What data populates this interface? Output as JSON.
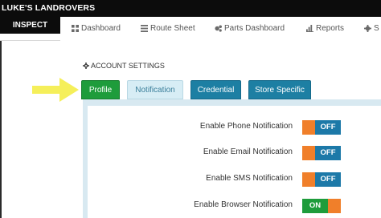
{
  "window": {
    "title": "LUKE'S LANDROVERS"
  },
  "nav": {
    "active_tab": "INSPECT",
    "items": [
      {
        "label": "Dashboard",
        "icon": "grid-icon"
      },
      {
        "label": "Route Sheet",
        "icon": "list-icon"
      },
      {
        "label": "Parts Dashboard",
        "icon": "gears-icon"
      },
      {
        "label": "Reports",
        "icon": "bar-chart-icon"
      },
      {
        "label": "S",
        "icon": "gear-icon"
      }
    ]
  },
  "settings": {
    "heading": "ACCOUNT SETTINGS",
    "tabs": [
      {
        "label": "Profile",
        "state": "active"
      },
      {
        "label": "Notification",
        "state": "highlighted"
      },
      {
        "label": "Credential",
        "state": "normal"
      },
      {
        "label": "Store Specific",
        "state": "normal"
      }
    ]
  },
  "notifications": [
    {
      "label": "Enable Phone Notification",
      "state": "OFF",
      "enabled": false
    },
    {
      "label": "Enable Email Notification",
      "state": "OFF",
      "enabled": false
    },
    {
      "label": "Enable SMS Notification",
      "state": "OFF",
      "enabled": false
    },
    {
      "label": "Enable Browser Notification",
      "state": "ON",
      "enabled": true
    }
  ],
  "colors": {
    "profile_tab": "#1e9c3b",
    "notification_tab": "#d7edf5",
    "tab_blue": "#1d7fa3",
    "toggle_off_blue": "#1c79a8",
    "toggle_orange": "#f07f2a",
    "toggle_on_green": "#1e9c3b",
    "annotation_arrow": "#f5ef5a"
  }
}
